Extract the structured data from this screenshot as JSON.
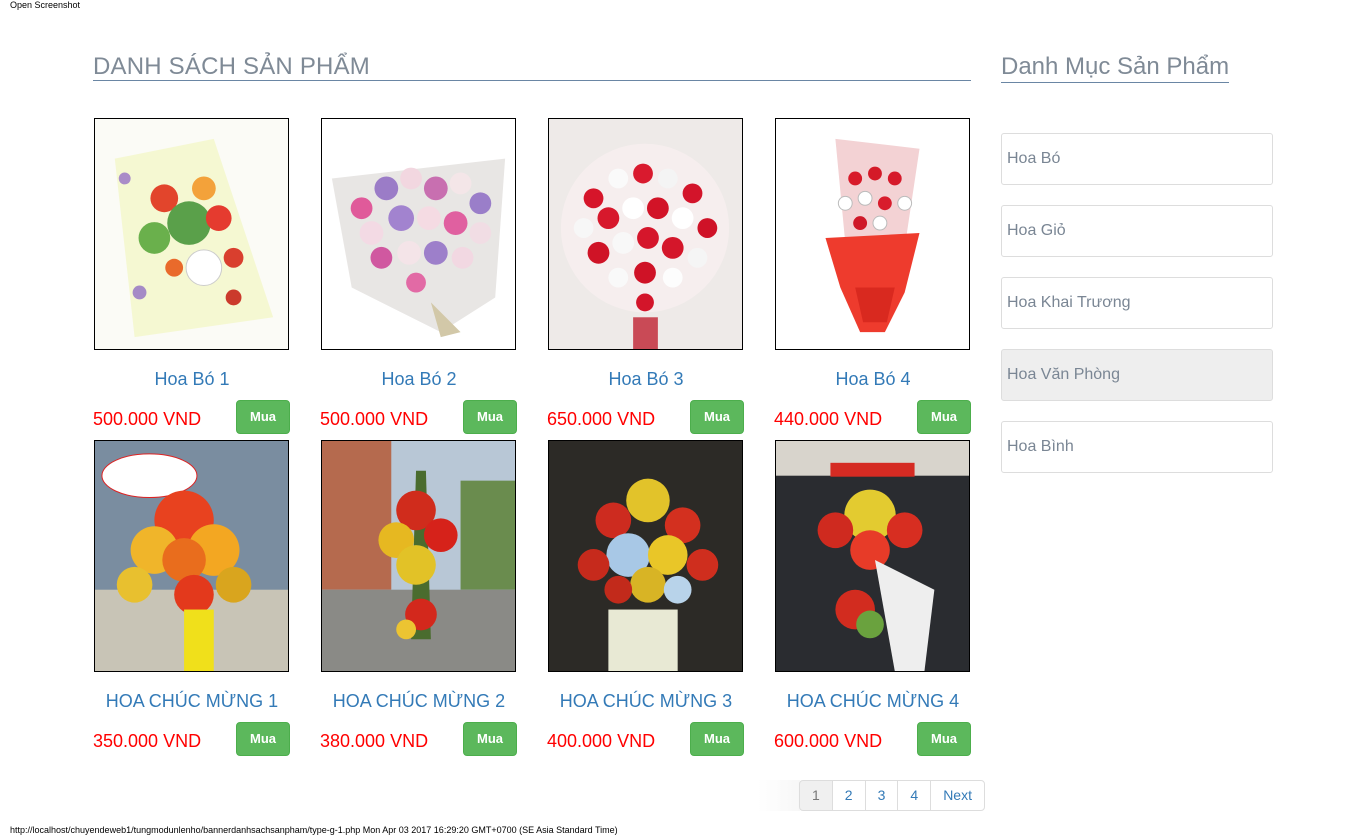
{
  "topbar": {
    "label": "Open Screenshot"
  },
  "main": {
    "title": "DANH SÁCH SẢN PHẨM"
  },
  "products": [
    {
      "name": "Hoa Bó 1",
      "price": "500.000 VND",
      "buy": "Mua"
    },
    {
      "name": "Hoa Bó 2",
      "price": "500.000 VND",
      "buy": "Mua"
    },
    {
      "name": "Hoa Bó 3",
      "price": "650.000 VND",
      "buy": "Mua"
    },
    {
      "name": "Hoa Bó 4",
      "price": "440.000 VND",
      "buy": "Mua"
    },
    {
      "name": "HOA CHÚC MỪNG 1",
      "price": "350.000 VND",
      "buy": "Mua"
    },
    {
      "name": "HOA CHÚC MỪNG 2",
      "price": "380.000 VND",
      "buy": "Mua"
    },
    {
      "name": "HOA CHÚC MỪNG 3",
      "price": "400.000 VND",
      "buy": "Mua"
    },
    {
      "name": "HOA CHÚC MỪNG 4",
      "price": "600.000 VND",
      "buy": "Mua"
    }
  ],
  "pagination": {
    "pages": [
      "1",
      "2",
      "3",
      "4"
    ],
    "next": "Next",
    "current": "1"
  },
  "sidebar": {
    "title": "Danh Mục Sản Phẩm",
    "items": [
      {
        "label": "Hoa Bó"
      },
      {
        "label": "Hoa Giỏ"
      },
      {
        "label": "Hoa Khai Trương"
      },
      {
        "label": "Hoa Văn Phòng"
      },
      {
        "label": "Hoa Bình"
      }
    ],
    "active": "Hoa Văn Phòng"
  },
  "footer": {
    "text": "http://localhost/chuyendeweb1/tungmodunlenho/bannerdanhsachsanpham/type-g-1.php Mon Apr 03 2017 16:29:20 GMT+0700 (SE Asia Standard Time)"
  },
  "colors": {
    "link": "#337ab7",
    "price": "#ff0000",
    "buy_button": "#5cb85c",
    "heading": "#7f8a96"
  }
}
